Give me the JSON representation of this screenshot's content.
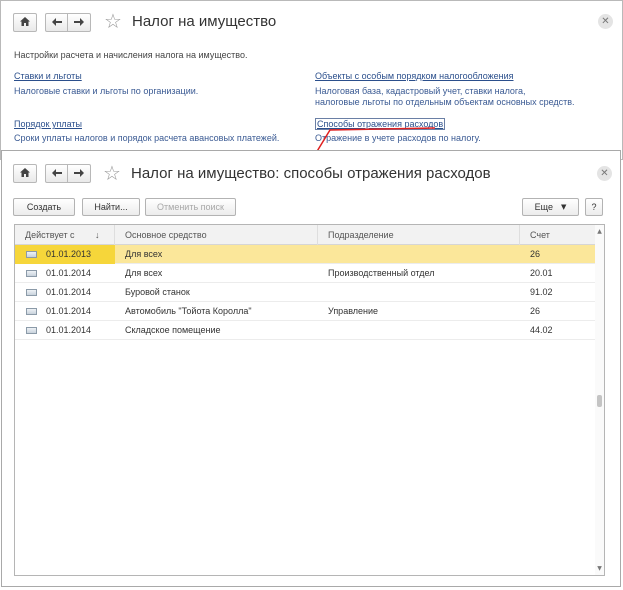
{
  "back_window": {
    "title": "Налог на имущество",
    "intro": "Настройки расчета и начисления налога на имущество.",
    "sections": [
      {
        "link": "Ставки и льготы",
        "desc": "Налоговые ставки и льготы по организации."
      },
      {
        "link": "Порядок уплаты",
        "desc": "Сроки уплаты налогов и порядок расчета авансовых платежей."
      },
      {
        "link": "Объекты с особым порядком налогообложения",
        "desc1": "Налоговая база, кадастровый учет, ставки налога,",
        "desc2": "налоговые льготы по отдельным объектам основных средств."
      },
      {
        "link": "Способы отражения расходов",
        "desc": "Отражение в учете расходов по налогу."
      }
    ]
  },
  "front_window": {
    "title": "Налог на имущество: способы отражения расходов",
    "toolbar": {
      "create": "Создать",
      "find": "Найти...",
      "cancel_search": "Отменить поиск",
      "more": "Еще",
      "help": "?"
    },
    "columns": [
      "Действует с",
      "Основное средство",
      "Подразделение",
      "Счет"
    ],
    "sort_arrow": "↓",
    "rows": [
      {
        "date": "01.01.2013",
        "asset": "Для всех",
        "dept": "",
        "account": "26"
      },
      {
        "date": "01.01.2014",
        "asset": "Для всех",
        "dept": "Производственный отдел",
        "account": "20.01"
      },
      {
        "date": "01.01.2014",
        "asset": "Буровой станок",
        "dept": "",
        "account": "91.02"
      },
      {
        "date": "01.01.2014",
        "asset": "Автомобиль \"Тойота Королла\"",
        "dept": "Управление",
        "account": "26"
      },
      {
        "date": "01.01.2014",
        "asset": "Складское помещение",
        "dept": "",
        "account": "44.02"
      }
    ]
  },
  "icons": {
    "home": "home-icon",
    "back": "arrow-left-icon",
    "forward": "arrow-right-icon",
    "favorite": "star-icon",
    "close": "close-icon",
    "dropdown": "triangle-down-icon",
    "row": "record-icon"
  },
  "colors": {
    "link": "#2b4f8c",
    "selected_row": "#fbe79a",
    "selected_cell": "#f6d63a",
    "connector": "#e02020"
  }
}
